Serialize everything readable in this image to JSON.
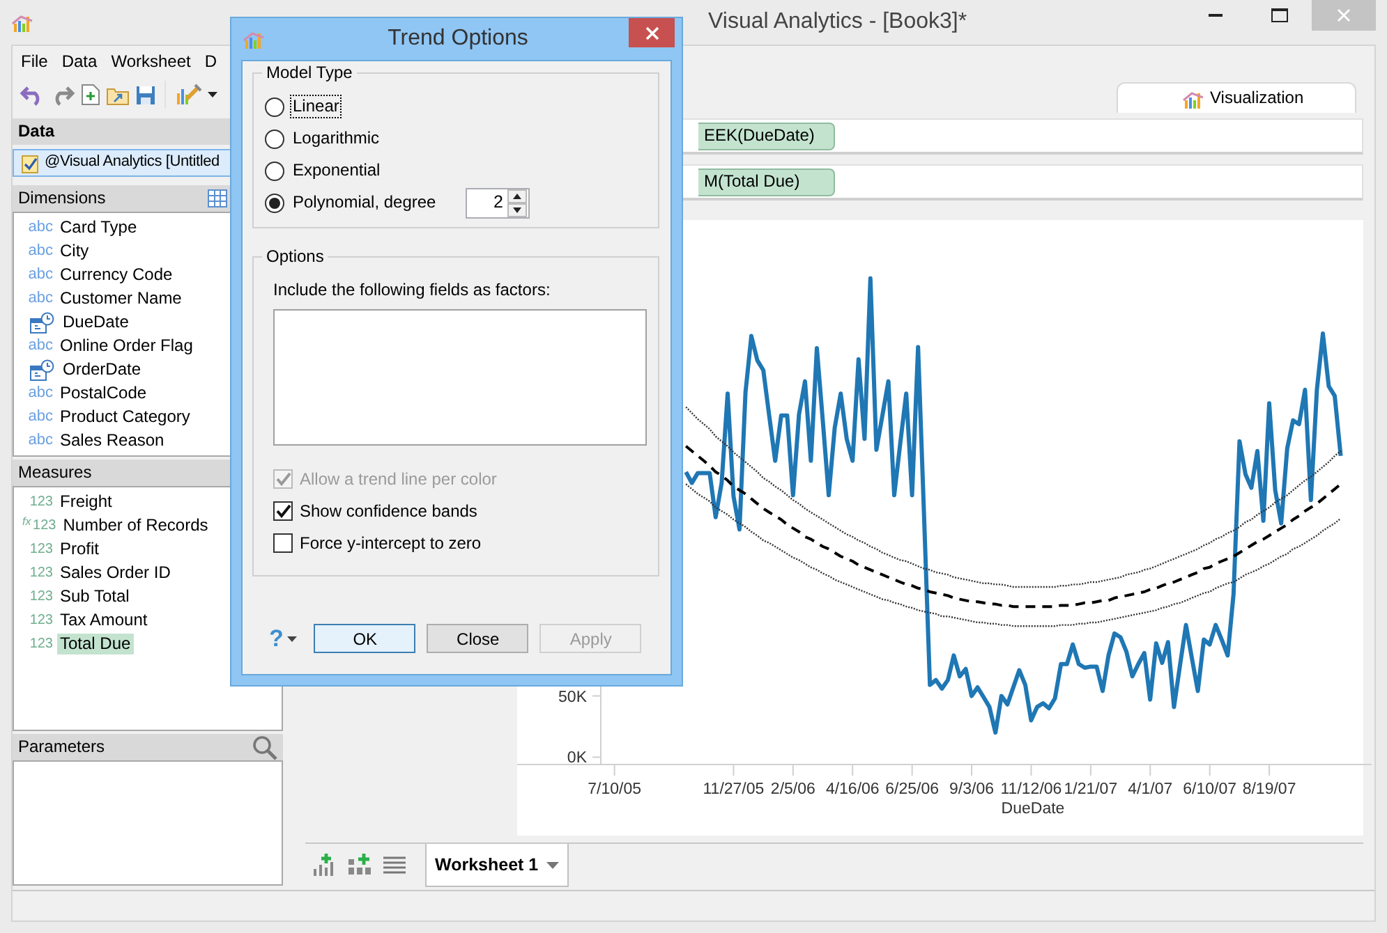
{
  "window": {
    "title": "Visual Analytics - [Book3]*"
  },
  "menu": [
    "File",
    "Data",
    "Worksheet",
    "D"
  ],
  "view_tabs": [
    {
      "label": "Visualization",
      "selected": true
    }
  ],
  "data_panel": {
    "title": "Data",
    "sources": [
      {
        "label": "@Visual Analytics [Untitled",
        "selected": true
      }
    ]
  },
  "dimensions": {
    "title": "Dimensions",
    "fields": [
      {
        "kind": "text",
        "badge": "abc",
        "label": "Card Type"
      },
      {
        "kind": "text",
        "badge": "abc",
        "label": "City"
      },
      {
        "kind": "text",
        "badge": "abc",
        "label": "Currency Code"
      },
      {
        "kind": "text",
        "badge": "abc",
        "label": "Customer Name"
      },
      {
        "kind": "date",
        "label": "DueDate"
      },
      {
        "kind": "text",
        "badge": "abc",
        "label": "Online Order Flag"
      },
      {
        "kind": "date",
        "label": "OrderDate"
      },
      {
        "kind": "text",
        "badge": "abc",
        "label": "PostalCode"
      },
      {
        "kind": "text",
        "badge": "abc",
        "label": "Product Category"
      },
      {
        "kind": "text",
        "badge": "abc",
        "label": "Sales Reason"
      }
    ]
  },
  "measures": {
    "title": "Measures",
    "fields": [
      {
        "kind": "number",
        "badge": "123",
        "label": "Freight",
        "selected": false
      },
      {
        "kind": "calculated",
        "prefix": "fx",
        "badge": "123",
        "label": "Number of Records",
        "selected": false
      },
      {
        "kind": "number",
        "badge": "123",
        "label": "Profit",
        "selected": false
      },
      {
        "kind": "number",
        "badge": "123",
        "label": "Sales Order ID",
        "selected": false
      },
      {
        "kind": "number",
        "badge": "123",
        "label": "Sub Total",
        "selected": false
      },
      {
        "kind": "number",
        "badge": "123",
        "label": "Tax Amount",
        "selected": false
      },
      {
        "kind": "number",
        "badge": "123",
        "label": "Total Due",
        "selected": true
      }
    ]
  },
  "parameters": {
    "title": "Parameters"
  },
  "shelves": [
    {
      "pill": "EEK(DueDate)"
    },
    {
      "pill": "M(Total Due)"
    }
  ],
  "chart": {
    "chart_data": {
      "type": "line",
      "xlabel": "DueDate",
      "categories": [
        "7/10/05",
        null,
        null,
        null,
        null,
        null,
        null,
        null,
        null,
        null,
        null,
        null,
        null,
        null,
        null,
        null,
        null,
        null,
        null,
        null,
        "11/27/05",
        null,
        null,
        null,
        null,
        null,
        null,
        null,
        null,
        null,
        "2/5/06",
        null,
        null,
        null,
        null,
        null,
        null,
        null,
        null,
        null,
        "4/16/06",
        null,
        null,
        null,
        null,
        null,
        null,
        null,
        null,
        null,
        "6/25/06",
        null,
        null,
        null,
        null,
        null,
        null,
        null,
        null,
        null,
        "9/3/06",
        null,
        null,
        null,
        null,
        null,
        null,
        null,
        null,
        null,
        "11/12/06",
        null,
        null,
        null,
        null,
        null,
        null,
        null,
        null,
        null,
        "1/21/07",
        null,
        null,
        null,
        null,
        null,
        null,
        null,
        null,
        null,
        "4/1/07",
        null,
        null,
        null,
        null,
        null,
        null,
        null,
        null,
        null,
        "6/10/07",
        null,
        null,
        null,
        null,
        null,
        null,
        null,
        null,
        null,
        "8/19/07",
        null,
        null,
        null,
        null,
        null,
        null,
        null,
        null,
        null,
        null,
        null,
        null
      ],
      "series": [
        {
          "color": "#1f77b4",
          "values": [
            null,
            null,
            null,
            null,
            null,
            null,
            null,
            null,
            null,
            null,
            null,
            null,
            233,
            224,
            232,
            232,
            232,
            196,
            224,
            297,
            213,
            186,
            298,
            344,
            324,
            316,
            279,
            242,
            279,
            279,
            214,
            280,
            307,
            242,
            334,
            274,
            214,
            269,
            297,
            260,
            242,
            325,
            260,
            391,
            251,
            279,
            307,
            214,
            256,
            297,
            214,
            335,
            197,
            59,
            63,
            56,
            63,
            83,
            66,
            72,
            50,
            57,
            49,
            41,
            20,
            50,
            43,
            57,
            71,
            59,
            30,
            41,
            44,
            40,
            48,
            76,
            76,
            92,
            76,
            73,
            74,
            74,
            54,
            83,
            101,
            98,
            86,
            66,
            76,
            85,
            47,
            93,
            77,
            94,
            41,
            75,
            108,
            81,
            54,
            96,
            92,
            108,
            96,
            83,
            133,
            258,
            231,
            220,
            250,
            193,
            289,
            218,
            191,
            252,
            275,
            272,
            300,
            210,
            300,
            346,
            303,
            295,
            246
          ]
        },
        {
          "color": "#000000",
          "line_style": "dashed",
          "values": [
            null,
            null,
            null,
            null,
            null,
            null,
            null,
            null,
            null,
            null,
            null,
            null,
            254,
            250,
            246,
            242,
            238,
            233,
            230,
            226,
            221,
            218,
            215,
            211,
            207,
            203,
            200,
            197,
            194,
            190,
            187,
            184,
            180,
            178,
            175,
            172,
            170,
            167,
            164,
            162,
            160,
            157,
            155,
            153,
            151,
            149,
            147,
            145,
            143,
            141,
            140,
            138,
            137,
            135,
            134,
            133,
            132,
            130,
            129,
            128,
            127,
            127,
            126,
            125,
            125,
            124,
            124,
            123,
            123,
            123,
            123,
            123,
            123,
            123,
            123,
            124,
            124,
            124,
            125,
            126,
            126,
            127,
            128,
            128,
            130,
            131,
            132,
            133,
            134,
            135,
            137,
            138,
            140,
            142,
            143,
            145,
            147,
            149,
            151,
            154,
            155,
            158,
            160,
            162,
            164,
            167,
            170,
            173,
            176,
            178,
            181,
            184,
            187,
            190,
            194,
            197,
            201,
            204,
            207,
            211,
            215,
            219,
            223
          ]
        },
        {
          "color": "#333333",
          "line_style": "dotted",
          "values": [
            null,
            null,
            null,
            null,
            null,
            null,
            null,
            null,
            null,
            null,
            null,
            null,
            286,
            281,
            276,
            272,
            268,
            262,
            258,
            254,
            249,
            245,
            241,
            237,
            233,
            228,
            225,
            221,
            218,
            214,
            210,
            207,
            203,
            200,
            197,
            194,
            191,
            188,
            185,
            182,
            180,
            177,
            175,
            172,
            170,
            167,
            165,
            163,
            161,
            160,
            158,
            156,
            154,
            153,
            151,
            150,
            149,
            147,
            146,
            145,
            144,
            143,
            142,
            142,
            141,
            141,
            140,
            139,
            139,
            139,
            139,
            139,
            139,
            139,
            139,
            140,
            140,
            141,
            141,
            142,
            143,
            143,
            144,
            145,
            146,
            147,
            149,
            150,
            151,
            153,
            154,
            156,
            158,
            160,
            162,
            164,
            166,
            168,
            170,
            173,
            175,
            178,
            180,
            183,
            185,
            188,
            192,
            194,
            198,
            201,
            204,
            208,
            211,
            214,
            218,
            222,
            226,
            229,
            233,
            237,
            241,
            246,
            250
          ]
        },
        {
          "color": "#333333",
          "line_style": "dotted",
          "values": [
            null,
            null,
            null,
            null,
            null,
            null,
            null,
            null,
            null,
            null,
            null,
            null,
            223,
            219,
            215,
            212,
            209,
            204,
            201,
            198,
            194,
            191,
            188,
            184,
            181,
            177,
            175,
            172,
            169,
            166,
            163,
            161,
            158,
            155,
            153,
            150,
            148,
            145,
            143,
            141,
            139,
            137,
            135,
            133,
            131,
            129,
            128,
            126,
            125,
            123,
            122,
            120,
            119,
            118,
            117,
            115,
            115,
            114,
            113,
            112,
            111,
            110,
            110,
            109,
            109,
            108,
            108,
            107,
            107,
            107,
            107,
            107,
            107,
            107,
            107,
            108,
            108,
            108,
            109,
            109,
            110,
            110,
            111,
            112,
            113,
            114,
            115,
            116,
            117,
            118,
            119,
            120,
            122,
            123,
            125,
            126,
            128,
            130,
            132,
            134,
            135,
            138,
            140,
            142,
            143,
            146,
            149,
            151,
            153,
            156,
            158,
            161,
            164,
            166,
            170,
            172,
            175,
            178,
            181,
            185,
            188,
            191,
            195
          ]
        }
      ],
      "ylim": [
        -6,
        433
      ],
      "yticks": [
        {
          "value": 0,
          "label": "0K"
        },
        {
          "value": 50,
          "label": "50K"
        }
      ]
    }
  },
  "sheet_tabs": [
    {
      "label": "Worksheet 1",
      "selected": true
    }
  ],
  "dialog": {
    "title": "Trend Options",
    "model_type": {
      "title": "Model Type",
      "degree": "2",
      "options": [
        {
          "kind": "linear",
          "label": "Linear",
          "selected": false,
          "focused": true
        },
        {
          "kind": "logarithmic",
          "label": "Logarithmic",
          "selected": false,
          "focused": false
        },
        {
          "kind": "exponential",
          "label": "Exponential",
          "selected": false,
          "focused": false
        },
        {
          "kind": "polynomial",
          "label": "Polynomial, degree",
          "selected": true,
          "focused": false
        }
      ]
    },
    "options": {
      "title": "Options",
      "factors_label": "Include the following fields as factors:",
      "checkboxes": [
        {
          "label": "Allow a trend line per color",
          "checked": true,
          "disabled": true
        },
        {
          "label": "Show confidence bands",
          "checked": true,
          "disabled": false
        },
        {
          "label": "Force y-intercept to zero",
          "checked": false,
          "disabled": false
        }
      ]
    },
    "help": "?",
    "buttons": [
      {
        "label": "OK",
        "default": true,
        "disabled": false
      },
      {
        "label": "Close",
        "default": false,
        "disabled": false
      },
      {
        "label": "Apply",
        "default": false,
        "disabled": true
      }
    ]
  }
}
